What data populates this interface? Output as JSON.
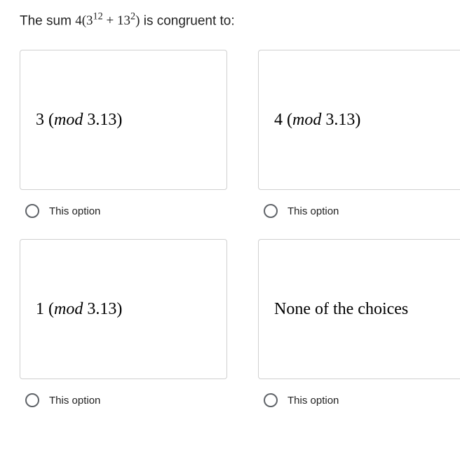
{
  "question": {
    "prefix": "The sum ",
    "expr_a": "4(3",
    "sup1": "12",
    "expr_b": " + 13",
    "sup2": "2",
    "expr_c": ")",
    "suffix": " is congruent to:"
  },
  "options": [
    {
      "prefix": "3 (",
      "mod": "mod",
      "suffix": " 3.13)",
      "label": "This option"
    },
    {
      "prefix": "4 (",
      "mod": "mod",
      "suffix": " 3.13)",
      "label": "This option"
    },
    {
      "prefix": "1 (",
      "mod": "mod",
      "suffix": " 3.13)",
      "label": "This option"
    },
    {
      "full": "None of the choices",
      "label": "This option"
    }
  ]
}
